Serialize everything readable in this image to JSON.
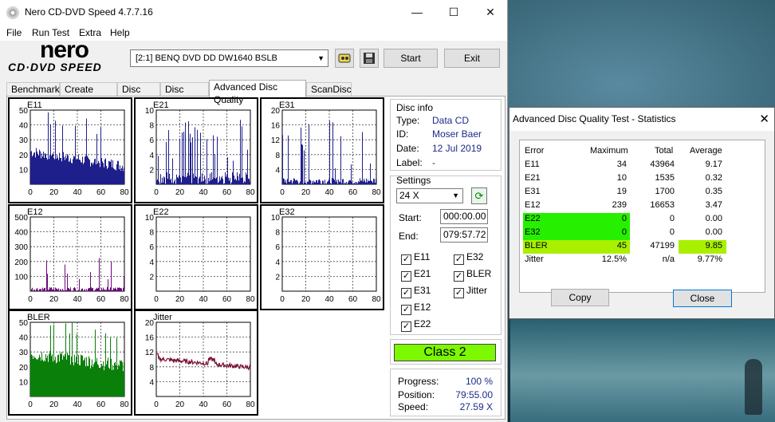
{
  "window": {
    "title": "Nero CD-DVD Speed 4.7.7.16",
    "minimize": "—",
    "maximize": "☐",
    "close": "✕"
  },
  "menu": [
    "File",
    "Run Test",
    "Extra",
    "Help"
  ],
  "logo": {
    "brand": "nero",
    "product": "CD·DVD SPEED"
  },
  "toolbar": {
    "drive": "[2:1]   BENQ DVD DD DW1640 BSLB",
    "start_label": "Start",
    "exit_label": "Exit"
  },
  "tabs": [
    {
      "label": "Benchmark",
      "active": false
    },
    {
      "label": "Create Disc",
      "active": false
    },
    {
      "label": "Disc Info",
      "active": false
    },
    {
      "label": "Disc Quality",
      "active": false
    },
    {
      "label": "Advanced Disc Quality",
      "active": true
    },
    {
      "label": "ScanDisc",
      "active": false
    }
  ],
  "disc_info": {
    "heading": "Disc info",
    "type_label": "Type:",
    "type": "Data CD",
    "id_label": "ID:",
    "id": "Moser Baer",
    "date_label": "Date:",
    "date": "12 Jul 2019",
    "label_label": "Label:",
    "label": "-"
  },
  "settings": {
    "heading": "Settings",
    "speed": "24 X",
    "start_label": "Start:",
    "start": "000:00.00",
    "end_label": "End:",
    "end": "079:57.72",
    "checkboxes": [
      {
        "label": "E11",
        "checked": true
      },
      {
        "label": "E32",
        "checked": true
      },
      {
        "label": "E21",
        "checked": true
      },
      {
        "label": "BLER",
        "checked": true
      },
      {
        "label": "E31",
        "checked": true
      },
      {
        "label": "Jitter",
        "checked": true
      },
      {
        "label": "E12",
        "checked": true
      },
      {
        "label": "E22",
        "checked": true
      }
    ]
  },
  "class_label": "Class 2",
  "progress": {
    "progress_label": "Progress:",
    "progress": "100 %",
    "position_label": "Position:",
    "position": "79:55.00",
    "speed_label": "Speed:",
    "speed": "27.59 X"
  },
  "colors": {
    "navy": "#1f1f8c",
    "purple": "#6a0a7a",
    "green": "#0a7f0a",
    "maroon": "#7a1030",
    "class_green": "#7cf800"
  },
  "chart_data": [
    {
      "type": "bar",
      "title": "E11",
      "color": "#1f1f8c",
      "xlim": [
        0,
        80
      ],
      "ylim": [
        0,
        50
      ],
      "yticks": [
        10,
        20,
        30,
        40,
        50
      ],
      "xticks": [
        0,
        20,
        40,
        60,
        80
      ],
      "profile": "e11"
    },
    {
      "type": "bar",
      "title": "E21",
      "color": "#1f1f8c",
      "xlim": [
        0,
        80
      ],
      "ylim": [
        0,
        10
      ],
      "yticks": [
        2,
        4,
        6,
        8,
        10
      ],
      "xticks": [
        0,
        20,
        40,
        60,
        80
      ],
      "profile": "e21"
    },
    {
      "type": "bar",
      "title": "E31",
      "color": "#1f1f8c",
      "xlim": [
        0,
        80
      ],
      "ylim": [
        0,
        20
      ],
      "yticks": [
        4,
        8,
        12,
        16,
        20
      ],
      "xticks": [
        0,
        20,
        40,
        60,
        80
      ],
      "profile": "e31"
    },
    {
      "type": "bar",
      "title": "E12",
      "color": "#6a0a7a",
      "xlim": [
        0,
        80
      ],
      "ylim": [
        0,
        500
      ],
      "yticks": [
        100,
        200,
        300,
        400,
        500
      ],
      "xticks": [
        0,
        20,
        40,
        60,
        80
      ],
      "profile": "e12"
    },
    {
      "type": "bar",
      "title": "E22",
      "color": "#1f1f8c",
      "xlim": [
        0,
        80
      ],
      "ylim": [
        0,
        10
      ],
      "yticks": [
        2,
        4,
        6,
        8,
        10
      ],
      "xticks": [
        0,
        20,
        40,
        60,
        80
      ],
      "profile": "zero"
    },
    {
      "type": "bar",
      "title": "E32",
      "color": "#1f1f8c",
      "xlim": [
        0,
        80
      ],
      "ylim": [
        0,
        10
      ],
      "yticks": [
        2,
        4,
        6,
        8,
        10
      ],
      "xticks": [
        0,
        20,
        40,
        60,
        80
      ],
      "profile": "zero"
    },
    {
      "type": "bar",
      "title": "BLER",
      "color": "#0a7f0a",
      "xlim": [
        0,
        80
      ],
      "ylim": [
        0,
        50
      ],
      "yticks": [
        10,
        20,
        30,
        40,
        50
      ],
      "xticks": [
        0,
        20,
        40,
        60,
        80
      ],
      "profile": "bler"
    },
    {
      "type": "line",
      "title": "Jitter",
      "color": "#7a1030",
      "xlim": [
        0,
        80
      ],
      "ylim": [
        0,
        20
      ],
      "yticks": [
        4,
        8,
        12,
        16,
        20
      ],
      "xticks": [
        0,
        20,
        40,
        60,
        80
      ],
      "profile": "jitter"
    }
  ],
  "stats": {
    "title": "Advanced Disc Quality Test - Statistics",
    "headers": [
      "Error",
      "Maximum",
      "Total",
      "Average"
    ],
    "rows": [
      {
        "name": "E11",
        "max": "34",
        "total": "43964",
        "avg": "9.17",
        "hl": ""
      },
      {
        "name": "E21",
        "max": "10",
        "total": "1535",
        "avg": "0.32",
        "hl": ""
      },
      {
        "name": "E31",
        "max": "19",
        "total": "1700",
        "avg": "0.35",
        "hl": ""
      },
      {
        "name": "E12",
        "max": "239",
        "total": "16653",
        "avg": "3.47",
        "hl": ""
      },
      {
        "name": "E22",
        "max": "0",
        "total": "0",
        "avg": "0.00",
        "hl": "green"
      },
      {
        "name": "E32",
        "max": "0",
        "total": "0",
        "avg": "0.00",
        "hl": "green"
      },
      {
        "name": "BLER",
        "max": "45",
        "total": "47199",
        "avg": "9.85",
        "hl": "yellowgreen"
      },
      {
        "name": "Jitter",
        "max": "12.5%",
        "total": "n/a",
        "avg": "9.77%",
        "hl": ""
      }
    ],
    "copy_label": "Copy",
    "close_label": "Close"
  }
}
